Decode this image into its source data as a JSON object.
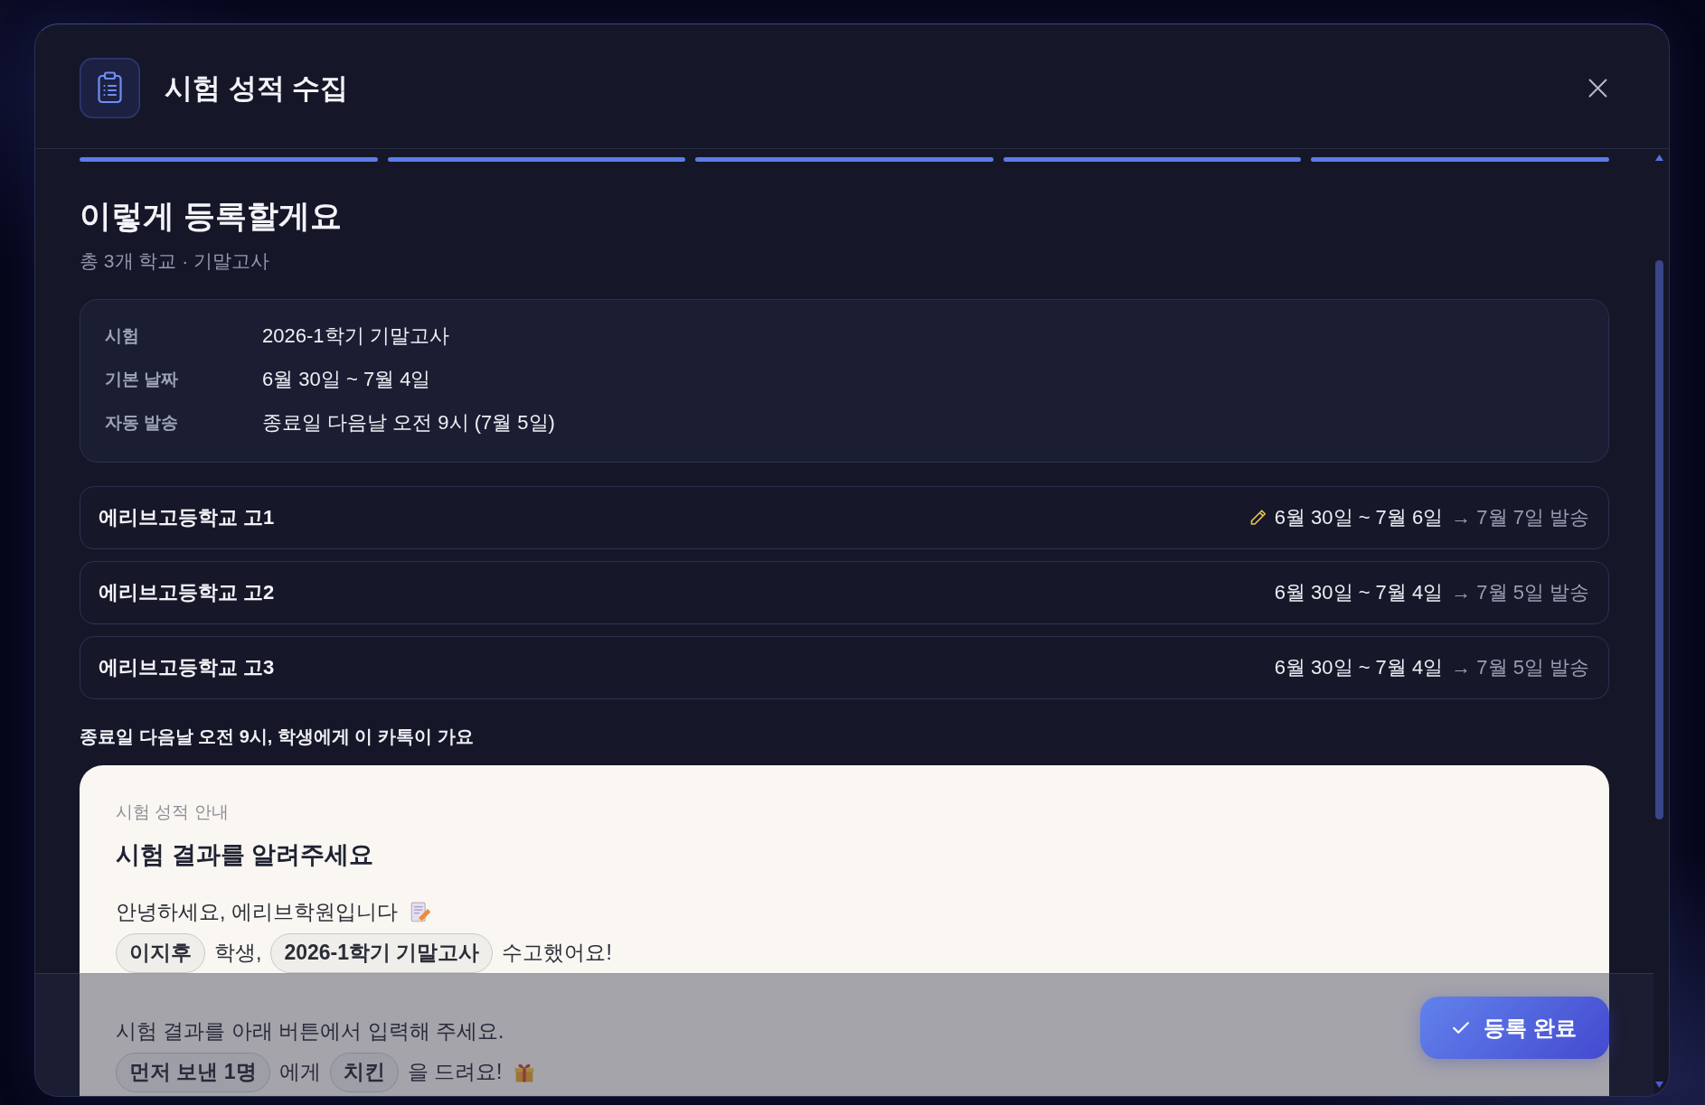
{
  "dialog": {
    "title": "시험 성적 수집"
  },
  "steps": [
    {
      "completed": true
    },
    {
      "completed": true
    },
    {
      "completed": true
    },
    {
      "completed": true
    },
    {
      "completed": true
    }
  ],
  "summary": {
    "heading": "이렇게 등록할게요",
    "subheading": "총 3개 학교 · 기말고사",
    "details": [
      {
        "label": "시험",
        "value": "2026-1학기 기말고사"
      },
      {
        "label": "기본 날짜",
        "value": "6월 30일 ~ 7월 4일"
      },
      {
        "label": "자동 발송",
        "value": "종료일 다음날 오전 9시 (7월 5일)"
      }
    ]
  },
  "schools": [
    {
      "name": "에리브고등학교 고1",
      "edited": true,
      "dates": "6월 30일 ~ 7월 6일",
      "send": "→ 7월 7일 발송"
    },
    {
      "name": "에리브고등학교 고2",
      "edited": false,
      "dates": "6월 30일 ~ 7월 4일",
      "send": "→ 7월 5일 발송"
    },
    {
      "name": "에리브고등학교 고3",
      "edited": false,
      "dates": "6월 30일 ~ 7월 4일",
      "send": "→ 7월 5일 발송"
    }
  ],
  "preview": {
    "caption": "종료일 다음날 오전 9시, 학생에게 이 카톡이 가요",
    "message": {
      "label": "시험 성적 안내",
      "title": "시험 결과를 알려주세요",
      "paragraphs": [
        {
          "lines": [
            {
              "parts": [
                {
                  "kind": "text",
                  "text": "안녕하세요, 에리브학원입니다"
                },
                {
                  "kind": "icon"
                }
              ]
            },
            {
              "parts": [
                {
                  "kind": "chip",
                  "text": "이지후"
                },
                {
                  "kind": "text",
                  "text": "학생,"
                },
                {
                  "kind": "chip",
                  "text": "2026-1학기 기말고사"
                },
                {
                  "kind": "text",
                  "text": "수고했어요!"
                }
              ]
            }
          ]
        },
        {
          "lines": [
            {
              "parts": [
                {
                  "kind": "text",
                  "text": "시험 결과를 아래 버튼에서 입력해 주세요."
                }
              ]
            },
            {
              "parts": [
                {
                  "kind": "chip",
                  "text": "먼저 보낸 1명"
                },
                {
                  "kind": "text",
                  "text": "에게"
                },
                {
                  "kind": "chip",
                  "text": "치킨"
                },
                {
                  "kind": "text",
                  "text": "을 드려요!"
                },
                {
                  "kind": "icon"
                }
              ]
            }
          ]
        }
      ]
    }
  },
  "footer": {
    "button": "등록 완료"
  }
}
